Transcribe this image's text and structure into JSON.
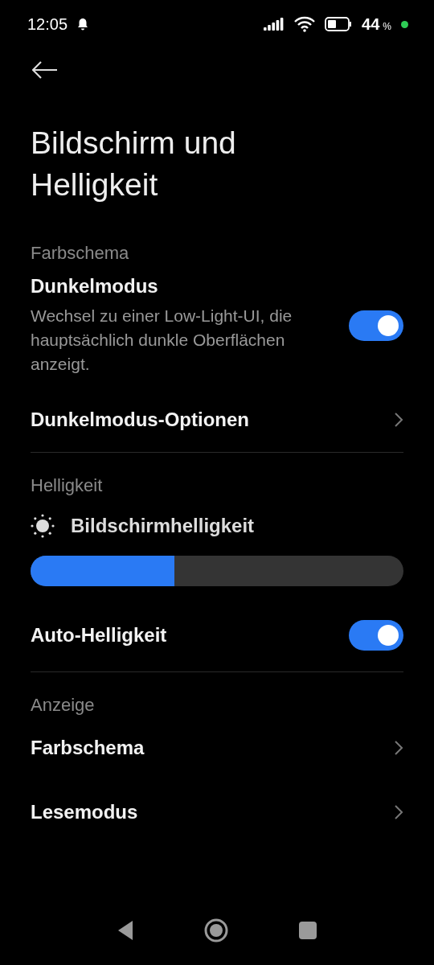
{
  "status_bar": {
    "time": "12:05",
    "battery": "44",
    "battery_unit": "%"
  },
  "title": "Bildschirm und Helligkeit",
  "sections": [
    {
      "heading": "Farbschema",
      "items": [
        {
          "kind": "toggle",
          "label": "Dunkelmodus",
          "description": "Wechsel zu einer Low-Light-UI, die hauptsächlich dunkle Oberflächen anzeigt.",
          "on": true
        },
        {
          "kind": "link",
          "label": "Dunkelmodus-Optionen"
        }
      ]
    },
    {
      "heading": "Helligkeit",
      "items": [
        {
          "kind": "slider",
          "label": "Bildschirmhelligkeit",
          "level": 0.385
        },
        {
          "kind": "toggle",
          "label": "Auto-Helligkeit",
          "on": true
        }
      ]
    },
    {
      "heading": "Anzeige",
      "items": [
        {
          "kind": "link",
          "label": "Farbschema"
        },
        {
          "kind": "link",
          "label": "Lesemodus"
        }
      ]
    }
  ]
}
